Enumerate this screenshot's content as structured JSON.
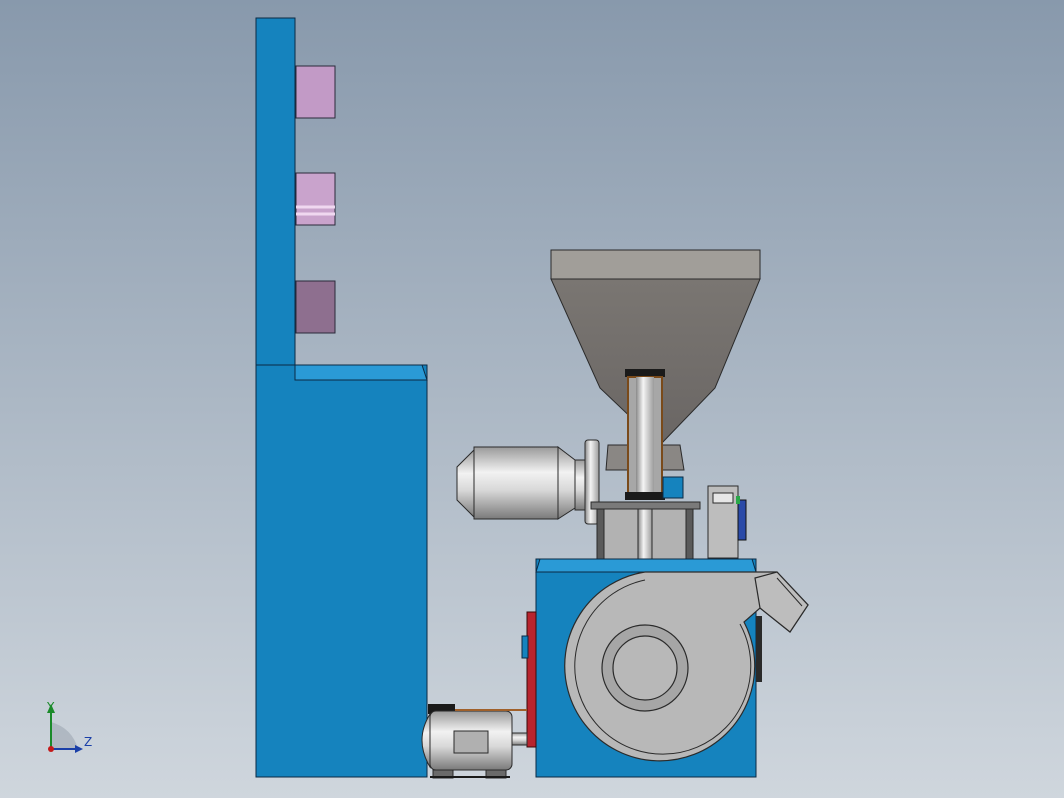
{
  "viewport": {
    "background_top": "#8899ac",
    "background_bottom": "#cfd6dd"
  },
  "colors": {
    "frame_blue": "#1583be",
    "frame_blue_light": "#2a9ad6",
    "hopper_top": "#a19e99",
    "hopper_body": "#75726f",
    "steel_light": "#e8e8e8",
    "steel_dark": "#8a8a8a",
    "blower_gray": "#b8b8b8",
    "flange_red": "#b8242e",
    "heater_pink": "#c29ac6",
    "heater_mauve": "#8e6f8f"
  },
  "triad": {
    "y_label": "Y",
    "z_label": "Z",
    "y_color": "#1a8a2a",
    "z_color": "#1a3fa8",
    "origin_color": "#c41a1a"
  }
}
